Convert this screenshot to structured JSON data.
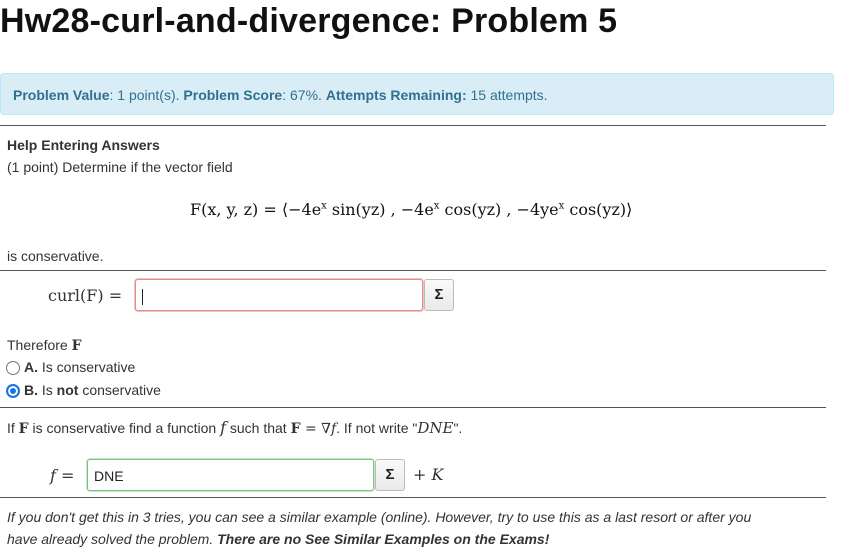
{
  "page_title": "Hw28-curl-and-divergence: Problem 5",
  "info": {
    "value_label": "Problem Value",
    "value_text": ": 1 point(s).",
    "score_label": "Problem Score",
    "score_text": ": 67%.",
    "attempts_label": "Attempts Remaining:",
    "attempts_text": " 15 attempts."
  },
  "help_link": "Help Entering Answers",
  "intro": "(1 point) Determine if the vector field",
  "formula": {
    "lhs": "F(x, y, z) = ⟨−4e",
    "sup1": "x",
    "part2": " sin(yz) , −4e",
    "sup2": "x",
    "part3": " cos(yz) , −4ye",
    "sup3": "x",
    "part4": " cos(yz)⟩"
  },
  "is_conservative": "is conservative.",
  "curl": {
    "label": "curl(F) =",
    "value": "",
    "sigma": "Σ"
  },
  "therefore": {
    "prefix": "Therefore ",
    "var": "F"
  },
  "options": [
    {
      "letter": "A.",
      "text": " Is conservative",
      "checked": false
    },
    {
      "letter": "B.",
      "text_pre": " Is ",
      "text_bold": "not",
      "text_post": " conservative",
      "checked": true
    }
  ],
  "question2": {
    "p1": "If ",
    "F": "F",
    "p2": " is conservative find a function ",
    "f": "f",
    "p3": " such that ",
    "F2": "F",
    "eq": " = ∇",
    "f2": "f",
    "p4": ". If not write \"",
    "dne": "DNE",
    "p5": "\"."
  },
  "f_answer": {
    "label": "f =",
    "value": "DNE",
    "sigma": "Σ",
    "plus_k": "+ K"
  },
  "footer": {
    "line1": "If you don't get this in 3 tries, you can see a similar example (online). However, try to use this as a last resort or after you",
    "line2_pre": "have already solved the problem. ",
    "line2_bold": "There are no See Similar Examples on the Exams!"
  }
}
